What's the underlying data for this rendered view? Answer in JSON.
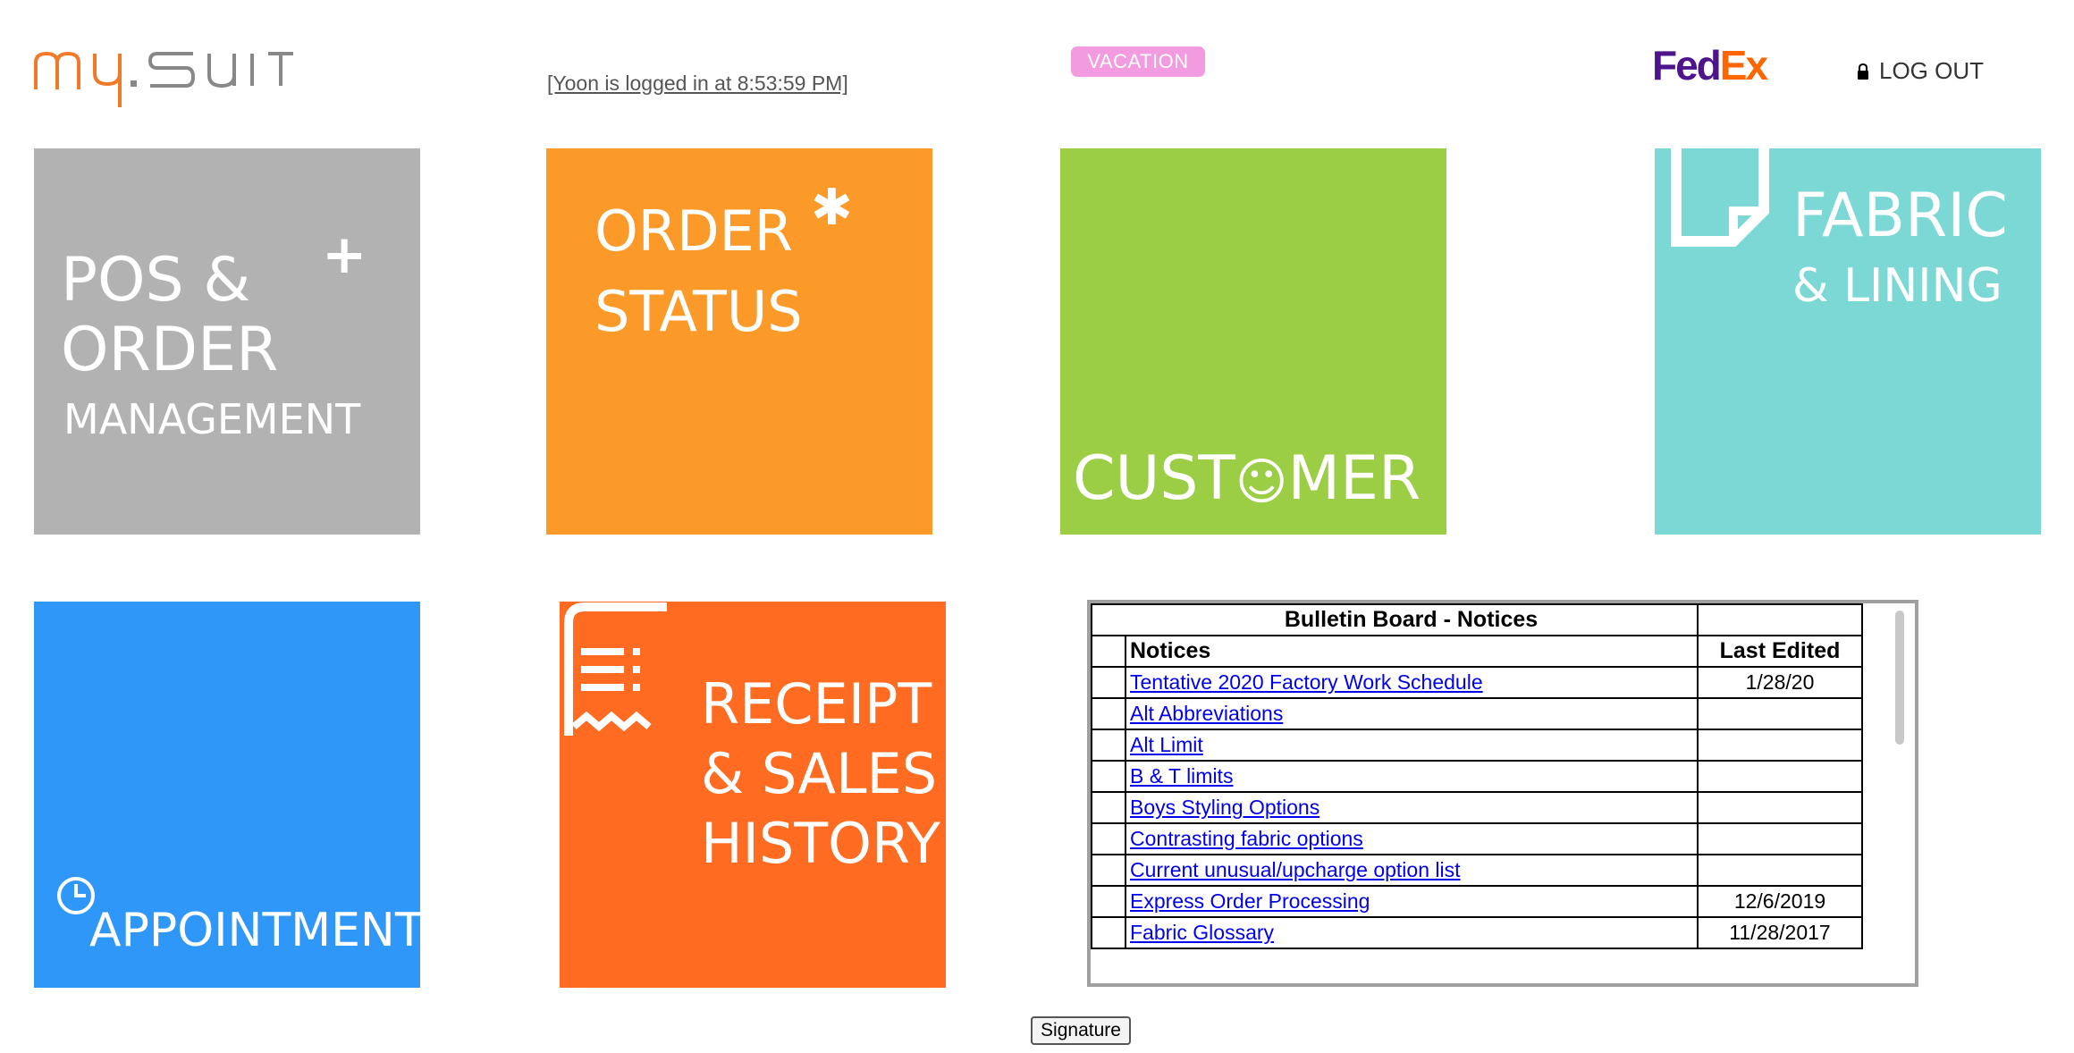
{
  "header": {
    "logo_text": "my.suit",
    "login_status": "[Yoon is logged in at 8:53:59 PM]",
    "vacation_badge": "VACATION",
    "fedex": {
      "fed": "Fed",
      "ex": "Ex"
    },
    "logout_label": "LOG OUT"
  },
  "tiles": {
    "pos": {
      "line1": "POS &",
      "line2": "ORDER",
      "line3": "MANAGEMENT",
      "symbol": "+"
    },
    "order_status": {
      "line1": "ORDER",
      "line2": "STATUS",
      "symbol": "✱"
    },
    "customer": {
      "label_a": "CUST",
      "label_b": "MER",
      "smiley": "☺"
    },
    "fabric": {
      "line1": "FABRIC",
      "line2": "& LINING"
    },
    "appointment": {
      "label": "APPOINTMENT"
    },
    "receipt": {
      "line1": "RECEIPT",
      "line2": "& SALES",
      "line3": "HISTORY"
    }
  },
  "bulletin": {
    "title": "Bulletin Board - Notices",
    "col_notices": "Notices",
    "col_last_edited": "Last Edited",
    "rows": [
      {
        "notice": "Tentative 2020 Factory Work Schedule",
        "date": "1/28/20"
      },
      {
        "notice": "Alt Abbreviations",
        "date": ""
      },
      {
        "notice": "Alt Limit",
        "date": ""
      },
      {
        "notice": "B & T limits",
        "date": ""
      },
      {
        "notice": "Boys Styling Options",
        "date": ""
      },
      {
        "notice": "Contrasting fabric options",
        "date": ""
      },
      {
        "notice": "Current unusual/upcharge option list",
        "date": ""
      },
      {
        "notice": "Express Order Processing",
        "date": "12/6/2019"
      },
      {
        "notice": "Fabric Glossary",
        "date": "11/28/2017"
      }
    ]
  },
  "signature_button": "Signature",
  "colors": {
    "pos": "#b2b2b2",
    "order_status": "#fc9a29",
    "customer": "#9bcd45",
    "fabric": "#7bd8d4",
    "appointment": "#2f97f8",
    "receipt": "#fe6b21",
    "vacation": "#f39be0",
    "fedex_purple": "#4d148c",
    "fedex_orange": "#ff6600"
  },
  "icons": [
    "plus-icon",
    "asterisk-icon",
    "smiley-icon",
    "document-icon",
    "clock-icon",
    "receipt-icon",
    "lock-icon"
  ]
}
